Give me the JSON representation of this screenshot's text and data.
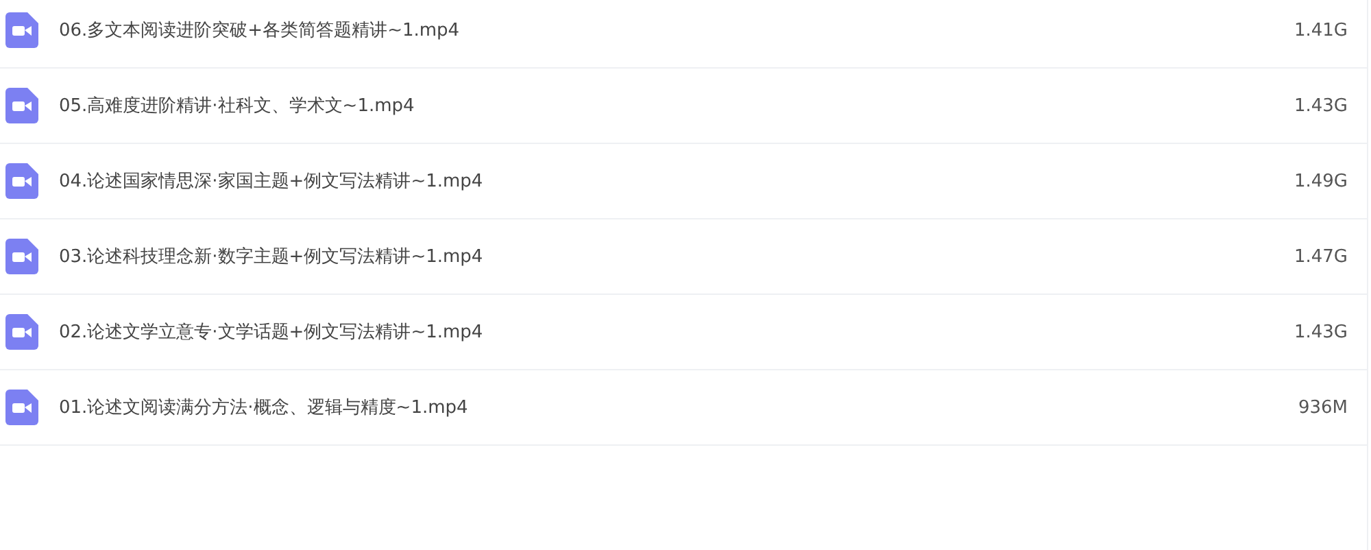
{
  "files": [
    {
      "name": "06.多文本阅读进阶突破+各类简答题精讲~1.mp4",
      "size": "1.41G"
    },
    {
      "name": "05.高难度进阶精讲·社科文、学术文~1.mp4",
      "size": "1.43G"
    },
    {
      "name": "04.论述国家情思深·家国主题+例文写法精讲~1.mp4",
      "size": "1.49G"
    },
    {
      "name": "03.论述科技理念新·数字主题+例文写法精讲~1.mp4",
      "size": "1.47G"
    },
    {
      "name": "02.论述文学立意专·文学话题+例文写法精讲~1.mp4",
      "size": "1.43G"
    },
    {
      "name": "01.论述文阅读满分方法·概念、逻辑与精度~1.mp4",
      "size": "936M"
    }
  ]
}
